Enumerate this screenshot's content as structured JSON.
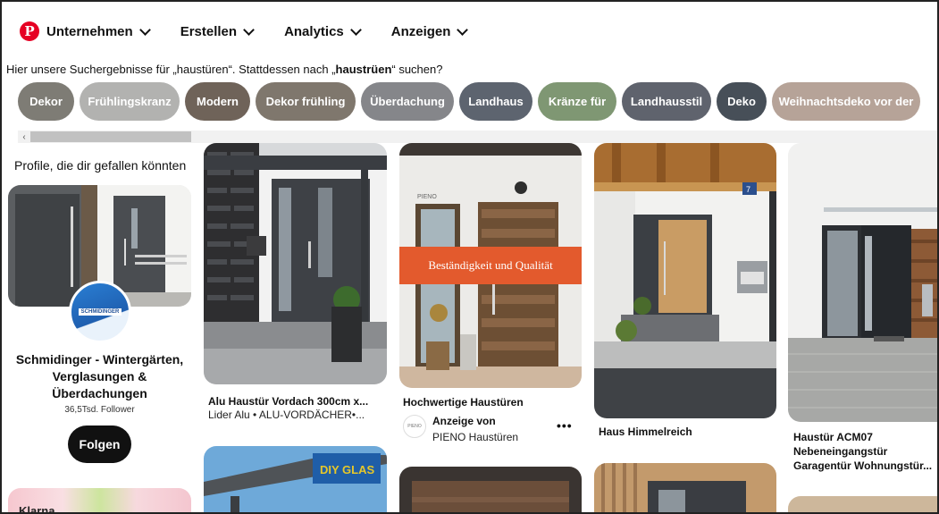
{
  "nav": {
    "logo": "P",
    "items": [
      "Unternehmen",
      "Erstellen",
      "Analytics",
      "Anzeigen"
    ]
  },
  "suggestion": {
    "prefix": "Hier unsere Suchergebnisse für „haustüren“. Stattdessen nach „",
    "query": "haustrüen",
    "suffix": "“ suchen?"
  },
  "chips": [
    {
      "label": "Dekor",
      "color": "#7e7c75"
    },
    {
      "label": "Frühlingskranz",
      "color": "#b2b2b0"
    },
    {
      "label": "Modern",
      "color": "#6f6359"
    },
    {
      "label": "Dekor frühling",
      "color": "#7f776d"
    },
    {
      "label": "Überdachung",
      "color": "#85868a"
    },
    {
      "label": "Landhaus",
      "color": "#5d646f"
    },
    {
      "label": "Kränze für",
      "color": "#7f9773"
    },
    {
      "label": "Landhausstil",
      "color": "#5f636d"
    },
    {
      "label": "Deko",
      "color": "#474f58"
    },
    {
      "label": "Weihnachtsdeko vor der",
      "color": "#b6a398"
    }
  ],
  "profiles": {
    "heading": "Profile, die dir gefallen könnten",
    "name": "Schmidinger - Wintergärten, Verglasungen & Überdachungen",
    "logo_text": "SCHMIDINGER",
    "followers": "36,5Tsd. Follower",
    "follow_label": "Folgen",
    "next_name": "Klarna"
  },
  "pins": {
    "pin1": {
      "title": "Alu Haustür Vordach 300cm x...",
      "subtitle": "Lider Alu • ALU-VORDÄCHER•..."
    },
    "pin2": {
      "title": "Hochwertige Haustüren",
      "overlay": "Beständigkeit und Qualität",
      "brand_mark": "PIENO",
      "ad_label": "Anzeige von",
      "advertiser": "PIENO Haustüren",
      "more": "•••"
    },
    "pin3": {
      "title": "Haus Himmelreich",
      "house_number": "7"
    },
    "pin4": {
      "title": "Haustür ACM07 Nebeneingangstür Garagentür Wohnungstür..."
    },
    "pin5": {
      "logo": "DIY GLAS"
    }
  },
  "scroll": {
    "left_arrow": "‹"
  }
}
